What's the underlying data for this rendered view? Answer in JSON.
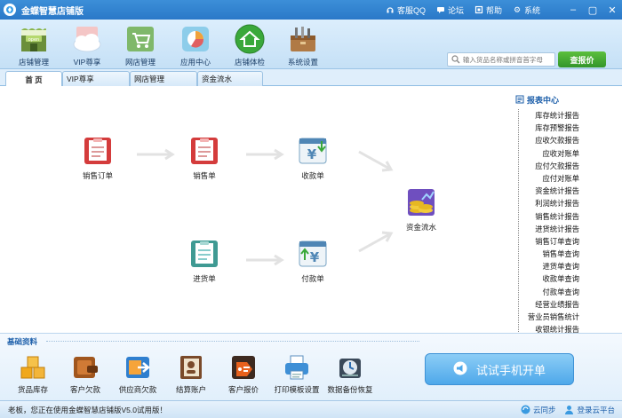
{
  "app": {
    "title": "金蝶智慧店铺版"
  },
  "titlebar": {
    "links": [
      {
        "icon": "headset-icon",
        "label": "客服QQ"
      },
      {
        "icon": "forum-icon",
        "label": "论坛"
      },
      {
        "icon": "help-icon",
        "label": "帮助"
      },
      {
        "icon": "gear-icon",
        "label": "系统"
      }
    ]
  },
  "toolbar": {
    "items": [
      {
        "id": "store-manage",
        "label": "店铺管理",
        "icon": "storefront-icon"
      },
      {
        "id": "vip",
        "label": "VIP尊享",
        "icon": "vip-cloud-icon"
      },
      {
        "id": "online-store",
        "label": "网店管理",
        "icon": "shopping-cart-icon"
      },
      {
        "id": "app-center",
        "label": "应用中心",
        "icon": "app-chart-icon"
      },
      {
        "id": "store-check",
        "label": "店铺体检",
        "icon": "home-check-icon"
      },
      {
        "id": "settings",
        "label": "系统设置",
        "icon": "toolbox-icon"
      }
    ],
    "search_placeholder": "输入货品名称或拼音首字母",
    "quote_button": "查报价"
  },
  "tabs": [
    {
      "label": "首 页",
      "active": true
    },
    {
      "label": "VIP尊享",
      "active": false
    },
    {
      "label": "网店管理",
      "active": false
    },
    {
      "label": "资金流水",
      "active": false
    }
  ],
  "flow": {
    "nodes": [
      {
        "id": "sales-order",
        "label": "销售订单",
        "icon": "sales-order-icon"
      },
      {
        "id": "sales-bill",
        "label": "销售单",
        "icon": "sales-bill-icon"
      },
      {
        "id": "receipt",
        "label": "收款单",
        "icon": "receipt-yuan-icon"
      },
      {
        "id": "purchase",
        "label": "进货单",
        "icon": "purchase-bill-icon"
      },
      {
        "id": "payment",
        "label": "付款单",
        "icon": "payment-yuan-icon"
      },
      {
        "id": "cashflow",
        "label": "资金流水",
        "icon": "coins-icon"
      }
    ]
  },
  "reports": {
    "title": "报表中心",
    "items": [
      "库存统计报告",
      "库存预警报告",
      "应收欠款报告",
      "应收对账单",
      "应付欠款报告",
      "应付对账单",
      "资金统计报告",
      "利润统计报告",
      "销售统计报告",
      "进货统计报告",
      "销售订单查询",
      "销售单查询",
      "进货单查询",
      "收款单查询",
      "付款单查询",
      "经营业绩报告",
      "营业员销售统计",
      "收银统计报告"
    ]
  },
  "basic": {
    "title": "基础资料",
    "items": [
      {
        "label": "货品库存",
        "icon": "stock-boxes-icon"
      },
      {
        "label": "客户欠款",
        "icon": "customer-debt-icon"
      },
      {
        "label": "供应商欠款",
        "icon": "supplier-debt-icon"
      },
      {
        "label": "结算账户",
        "icon": "account-book-icon"
      },
      {
        "label": "客户报价",
        "icon": "price-tag-icon"
      },
      {
        "label": "打印模板设置",
        "icon": "printer-icon"
      },
      {
        "label": "数据备份恢复",
        "icon": "backup-icon"
      }
    ]
  },
  "promo": {
    "label": "试试手机开单"
  },
  "status": {
    "message": "老板，您正在使用金蝶智慧店铺版V5.0试用版！",
    "links": [
      {
        "icon": "cloud-sync-icon",
        "label": "云同步"
      },
      {
        "icon": "user-icon",
        "label": "登录云平台"
      }
    ]
  },
  "colors": {
    "titlebar": "#2a78c8",
    "accent": "#1d5faa",
    "quote_button": "#33952a"
  }
}
